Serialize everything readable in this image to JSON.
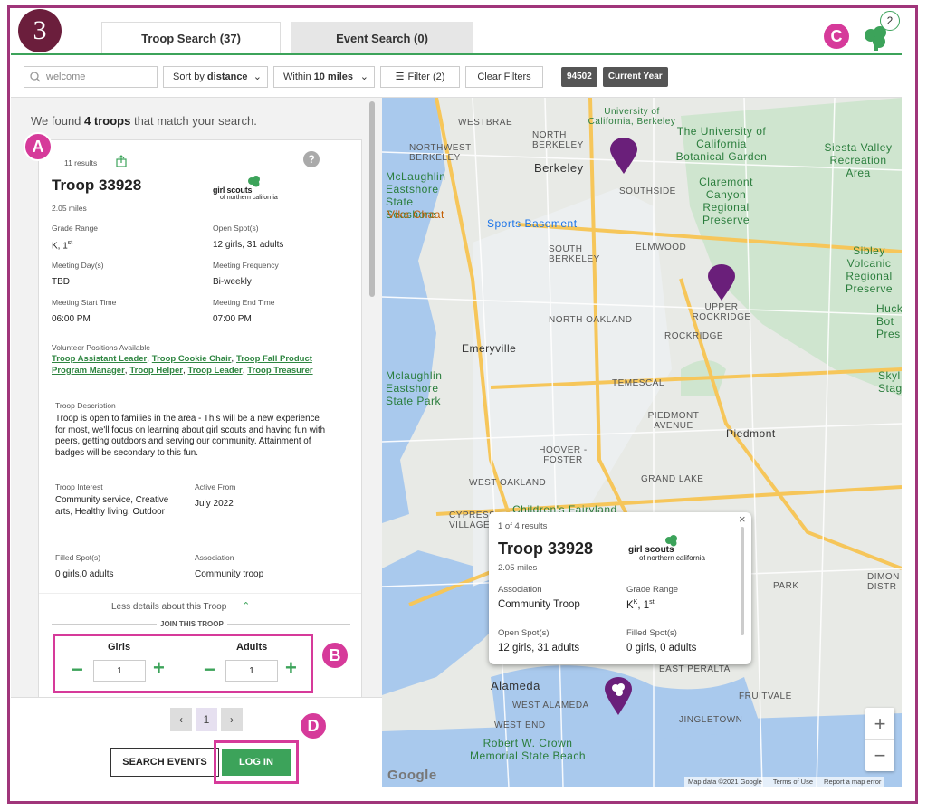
{
  "step_badge": "3",
  "callouts": {
    "a": "A",
    "b": "B",
    "c": "C",
    "d": "D"
  },
  "tabs": [
    {
      "label": "Troop Search (37)",
      "active": true
    },
    {
      "label": "Event Search (0)",
      "active": false
    }
  ],
  "cart_count": "2",
  "toolbar": {
    "search_value": "welcome",
    "sort_prefix": "Sort by",
    "sort_value": "distance",
    "within_prefix": "Within",
    "within_value": "10 miles",
    "filter_label": "Filter (2)",
    "clear_label": "Clear Filters",
    "chips": [
      "94502",
      "Current Year"
    ]
  },
  "results": {
    "prefix": "We found",
    "count": "4 troops",
    "suffix": "that match your search."
  },
  "card": {
    "results_count": "11 results",
    "troop_name": "Troop 33928",
    "distance": "2.05 miles",
    "logo_line1": "girl scouts",
    "logo_line2": "of northern california",
    "fields": {
      "grade_range_label": "Grade Range",
      "grade_range_value": "K, 1",
      "grade_range_sup": "st",
      "open_spots_label": "Open Spot(s)",
      "open_spots_value": "12 girls, 31 adults",
      "meeting_days_label": "Meeting Day(s)",
      "meeting_days_value": "TBD",
      "meeting_freq_label": "Meeting Frequency",
      "meeting_freq_value": "Bi-weekly",
      "start_label": "Meeting Start Time",
      "start_value": "06:00 PM",
      "end_label": "Meeting End Time",
      "end_value": "07:00 PM"
    },
    "volunteer_label": "Volunteer Positions Available",
    "volunteer_links": [
      "Troop Assistant Leader",
      "Troop Cookie Chair",
      "Troop Fall Product Program Manager",
      "Troop Helper",
      "Troop Leader",
      "Troop Treasurer"
    ],
    "description_label": "Troop Description",
    "description": "Troop is open to families in the area - This will be a new experience for most, we'll focus on learning about girl scouts and having fun with peers, getting outdoors and serving our community. Attainment of badges will be secondary to this fun.",
    "interest_label": "Troop Interest",
    "interest_value": "Community service, Creative arts, Healthy living, Outdoor",
    "active_from_label": "Active From",
    "active_from_value": "July 2022",
    "filled_label": "Filled Spot(s)",
    "filled_value": "0 girls,0 adults",
    "association_label": "Association",
    "association_value": "Community troop",
    "less_details": "Less details about this Troop",
    "join_label": "JOIN THIS TROOP",
    "girls_label": "Girls",
    "girls_value": "1",
    "adults_label": "Adults",
    "adults_value": "1"
  },
  "pager": {
    "current": "1"
  },
  "search_events_label": "SEARCH EVENTS",
  "login_label": "LOG IN",
  "popup": {
    "index": "1 of 4 results",
    "troop_name": "Troop 33928",
    "distance": "2.05 miles",
    "association_label": "Association",
    "association_value": "Community Troop",
    "grade_label": "Grade Range",
    "grade_value_k": "K",
    "grade_sup_k": "K",
    "grade_value_1": ", 1",
    "grade_sup_1": "st",
    "open_label": "Open Spot(s)",
    "open_value": "12 girls, 31 adults",
    "filled_label": "Filled Spot(s)",
    "filled_value": "0 girls, 0 adults"
  },
  "map": {
    "labels": {
      "westbrae": "WESTBRAE",
      "ucb": "University of California, Berkeley",
      "uc_garden": "The University of California Botanical Garden",
      "siesta": "Siesta Valley Recreation Area",
      "north_berkeley": "NORTH BERKELEY",
      "northwest_berkeley": "NORTHWEST BERKELEY",
      "berkeley": "Berkeley",
      "southside": "SOUTHSIDE",
      "claremont": "Claremont Canyon Regional Preserve",
      "mclaughlin_top": "McLaughlin Eastshore State Seashore",
      "viks": "Viks Chaat",
      "sports": "Sports Basement",
      "south_berkeley": "SOUTH BERKELEY",
      "elmwood": "ELMWOOD",
      "sibley": "Sibley Volcanic Regional Preserve",
      "upper_rockridge": "UPPER ROCKRIDGE",
      "north_oakland": "NORTH OAKLAND",
      "emeryville": "Emeryville",
      "rockridge": "ROCKRIDGE",
      "huck": "Huck Bot Pres",
      "mclaughlin_bottom": "Mclaughlin Eastshore State Park",
      "temescal": "TEMESCAL",
      "skyl": "Skyl Stag",
      "piedmont_ave": "PIEDMONT AVENUE",
      "piedmont": "Piedmont",
      "hoover": "HOOVER - FOSTER",
      "west_oakland": "WEST OAKLAND",
      "grand_lake": "GRAND LAKE",
      "fairyland": "Children's Fairyland",
      "cypress": "CYPRESS VILLAGE",
      "park": "PARK",
      "dimond": "DIMON DISTR",
      "alameda": "Alameda",
      "west_alameda": "WEST ALAMEDA",
      "east_peralta": "EAST PERALTA",
      "fruitvale": "FRUITVALE",
      "west_end": "WEST END",
      "jingletown": "JINGLETOWN",
      "crown": "Robert W. Crown Memorial State Beach",
      "google": "Google",
      "attrib_data": "Map data ©2021 Google",
      "attrib_terms": "Terms of Use",
      "attrib_report": "Report a map error"
    }
  },
  "colors": {
    "frame": "#a0357a",
    "pink": "#d63a9a",
    "green": "#3ca35a",
    "purple_pin": "#6a1f7a"
  }
}
